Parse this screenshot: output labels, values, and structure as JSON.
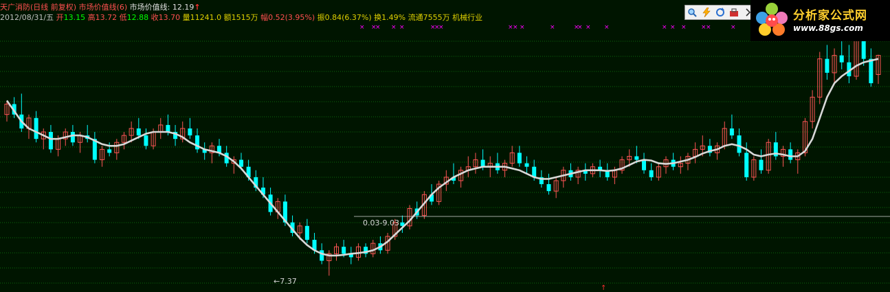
{
  "header": {
    "title": "天广消防(日线 前复权) 市场价值线(6)",
    "indicator_text": "市场价值线: 12.19",
    "up_arrow": "↑"
  },
  "quote": {
    "date": "2012/08/31/五",
    "open_label": "开",
    "open": "13.15",
    "high_label": "高",
    "high": "13.72",
    "low_label": "低",
    "low": "12.88",
    "close_label": "收",
    "close": "13.70",
    "volume_label": "量",
    "volume": "11241.0",
    "amount_label": "额",
    "amount": "1515万",
    "change_label": "幅",
    "change": "0.52(3.95%)",
    "amplitude_label": "振",
    "amplitude": "0.84(6.37%)",
    "turnover_label": "换",
    "turnover": "1.49%",
    "float_label": "流通",
    "float": "7555万",
    "industry": "机械行业"
  },
  "toolbar": {
    "icons": [
      "magnifier-icon",
      "lightning-icon",
      "refresh-icon",
      "toolbox-icon",
      "chevron-right-icon"
    ]
  },
  "logo": {
    "title": "分析家公式网",
    "url": "www.88gs.com"
  },
  "annotations": {
    "low_price": "←7.37",
    "range_label": "0.03-9.03"
  },
  "colors": {
    "background": "#001500",
    "grid": "#0b6a0b",
    "up": "#ff5555",
    "down": "#00ffff",
    "ma_line": "#d8d8d8",
    "date_text": "#c0c0c0",
    "label_red": "#ff5050",
    "value_green": "#00ff00",
    "title_text": "#e0d000",
    "cross_marks": "#ff00ff"
  },
  "chart_data": {
    "type": "candlestick",
    "ylim": [
      7.0,
      14.6
    ],
    "overlay_name": "市场价值线(6)",
    "candles": [
      [
        12.0,
        12.4,
        11.8,
        12.3
      ],
      [
        12.3,
        12.5,
        11.9,
        12.0
      ],
      [
        12.0,
        12.6,
        11.5,
        11.6
      ],
      [
        11.6,
        12.0,
        11.3,
        11.9
      ],
      [
        11.9,
        12.1,
        11.2,
        11.3
      ],
      [
        11.3,
        11.6,
        11.0,
        11.5
      ],
      [
        11.5,
        11.7,
        10.9,
        11.0
      ],
      [
        11.0,
        11.4,
        10.8,
        11.3
      ],
      [
        11.3,
        11.6,
        11.1,
        11.5
      ],
      [
        11.5,
        11.7,
        11.1,
        11.2
      ],
      [
        11.2,
        11.5,
        10.9,
        11.4
      ],
      [
        11.4,
        11.7,
        11.2,
        11.3
      ],
      [
        11.3,
        11.5,
        10.6,
        10.7
      ],
      [
        10.7,
        11.1,
        10.5,
        11.0
      ],
      [
        11.0,
        11.2,
        10.8,
        10.9
      ],
      [
        10.9,
        11.3,
        10.7,
        11.2
      ],
      [
        11.2,
        11.5,
        11.0,
        11.4
      ],
      [
        11.4,
        11.8,
        11.2,
        11.6
      ],
      [
        11.6,
        11.9,
        11.3,
        11.4
      ],
      [
        11.4,
        11.6,
        11.0,
        11.1
      ],
      [
        11.1,
        11.6,
        11.0,
        11.5
      ],
      [
        11.5,
        11.9,
        11.3,
        11.7
      ],
      [
        11.7,
        12.0,
        11.4,
        11.5
      ],
      [
        11.5,
        11.7,
        11.1,
        11.3
      ],
      [
        11.3,
        11.8,
        11.2,
        11.6
      ],
      [
        11.6,
        11.9,
        11.3,
        11.4
      ],
      [
        11.4,
        11.6,
        10.9,
        11.0
      ],
      [
        11.0,
        11.2,
        10.7,
        10.9
      ],
      [
        10.9,
        11.2,
        10.6,
        11.1
      ],
      [
        11.1,
        11.3,
        10.8,
        10.9
      ],
      [
        10.9,
        11.1,
        10.5,
        10.6
      ],
      [
        10.6,
        10.8,
        10.3,
        10.7
      ],
      [
        10.7,
        10.9,
        10.4,
        10.5
      ],
      [
        10.5,
        10.7,
        10.1,
        10.2
      ],
      [
        10.2,
        10.4,
        9.8,
        9.9
      ],
      [
        9.9,
        10.2,
        9.6,
        9.7
      ],
      [
        9.7,
        9.9,
        9.1,
        9.2
      ],
      [
        9.2,
        9.6,
        9.0,
        9.5
      ],
      [
        9.5,
        9.7,
        8.8,
        8.9
      ],
      [
        8.9,
        9.1,
        8.5,
        8.6
      ],
      [
        8.6,
        8.9,
        8.4,
        8.8
      ],
      [
        8.8,
        9.0,
        8.3,
        8.4
      ],
      [
        8.4,
        8.6,
        8.0,
        8.1
      ],
      [
        8.1,
        8.3,
        7.7,
        7.8
      ],
      [
        7.8,
        8.1,
        7.37,
        8.0
      ],
      [
        8.0,
        8.3,
        7.8,
        8.2
      ],
      [
        8.2,
        8.4,
        7.9,
        8.0
      ],
      [
        8.0,
        8.2,
        7.7,
        7.9
      ],
      [
        7.9,
        8.3,
        7.8,
        8.2
      ],
      [
        8.2,
        8.3,
        7.9,
        8.0
      ],
      [
        8.0,
        8.4,
        7.9,
        8.3
      ],
      [
        8.3,
        8.5,
        8.0,
        8.1
      ],
      [
        8.1,
        8.6,
        8.0,
        8.5
      ],
      [
        8.5,
        9.0,
        8.4,
        8.9
      ],
      [
        8.9,
        9.1,
        8.6,
        8.8
      ],
      [
        8.8,
        9.4,
        8.7,
        9.3
      ],
      [
        9.3,
        9.5,
        9.0,
        9.1
      ],
      [
        9.1,
        9.8,
        9.0,
        9.7
      ],
      [
        9.7,
        10.0,
        9.4,
        9.5
      ],
      [
        9.5,
        10.1,
        9.4,
        10.0
      ],
      [
        10.0,
        10.4,
        9.8,
        10.2
      ],
      [
        10.2,
        10.6,
        10.0,
        10.1
      ],
      [
        10.1,
        10.5,
        9.9,
        10.4
      ],
      [
        10.4,
        10.8,
        10.2,
        10.5
      ],
      [
        10.5,
        10.9,
        10.3,
        10.7
      ],
      [
        10.7,
        11.0,
        10.4,
        10.5
      ],
      [
        10.5,
        10.8,
        10.2,
        10.6
      ],
      [
        10.6,
        10.9,
        10.3,
        10.4
      ],
      [
        10.4,
        10.7,
        10.2,
        10.6
      ],
      [
        10.6,
        11.1,
        10.5,
        10.9
      ],
      [
        10.9,
        11.1,
        10.5,
        10.6
      ],
      [
        10.6,
        10.8,
        10.3,
        10.5
      ],
      [
        10.5,
        10.7,
        10.1,
        10.2
      ],
      [
        10.2,
        10.4,
        9.9,
        10.0
      ],
      [
        10.0,
        10.3,
        9.7,
        9.8
      ],
      [
        9.8,
        10.2,
        9.6,
        10.1
      ],
      [
        10.1,
        10.5,
        9.9,
        10.4
      ],
      [
        10.4,
        10.6,
        10.1,
        10.2
      ],
      [
        10.2,
        10.5,
        10.0,
        10.4
      ],
      [
        10.4,
        10.6,
        10.1,
        10.3
      ],
      [
        10.3,
        10.6,
        10.2,
        10.5
      ],
      [
        10.5,
        10.7,
        10.2,
        10.4
      ],
      [
        10.4,
        10.6,
        10.1,
        10.2
      ],
      [
        10.2,
        10.5,
        10.0,
        10.4
      ],
      [
        10.4,
        10.8,
        10.3,
        10.7
      ],
      [
        10.7,
        11.0,
        10.5,
        10.8
      ],
      [
        10.8,
        11.1,
        10.6,
        10.7
      ],
      [
        10.7,
        10.9,
        10.3,
        10.4
      ],
      [
        10.4,
        10.6,
        10.1,
        10.2
      ],
      [
        10.2,
        10.6,
        10.1,
        10.5
      ],
      [
        10.5,
        10.8,
        10.3,
        10.7
      ],
      [
        10.7,
        10.9,
        10.4,
        10.5
      ],
      [
        10.5,
        10.8,
        10.3,
        10.6
      ],
      [
        10.6,
        10.9,
        10.4,
        10.8
      ],
      [
        10.8,
        11.2,
        10.6,
        11.0
      ],
      [
        11.0,
        11.4,
        10.8,
        11.1
      ],
      [
        11.1,
        11.3,
        10.8,
        10.9
      ],
      [
        10.9,
        11.2,
        10.7,
        11.1
      ],
      [
        11.1,
        11.8,
        11.0,
        11.6
      ],
      [
        11.6,
        12.0,
        11.3,
        11.4
      ],
      [
        11.4,
        11.6,
        10.8,
        10.9
      ],
      [
        10.9,
        11.2,
        10.1,
        10.2
      ],
      [
        10.2,
        10.8,
        10.1,
        10.7
      ],
      [
        10.7,
        11.0,
        10.3,
        10.4
      ],
      [
        10.4,
        11.3,
        10.3,
        11.2
      ],
      [
        11.2,
        11.5,
        10.7,
        10.8
      ],
      [
        10.8,
        11.1,
        10.5,
        11.0
      ],
      [
        11.0,
        11.2,
        10.6,
        10.7
      ],
      [
        10.7,
        11.0,
        10.3,
        10.9
      ],
      [
        10.9,
        11.9,
        10.8,
        11.8
      ],
      [
        11.8,
        12.7,
        11.6,
        12.5
      ],
      [
        12.5,
        13.8,
        12.3,
        13.6
      ],
      [
        13.6,
        14.0,
        13.0,
        13.2
      ],
      [
        13.2,
        13.9,
        12.9,
        13.7
      ],
      [
        13.7,
        14.3,
        13.3,
        13.5
      ],
      [
        13.5,
        14.0,
        12.9,
        13.1
      ],
      [
        13.1,
        14.5,
        13.0,
        14.2
      ],
      [
        14.2,
        14.5,
        13.4,
        13.6
      ],
      [
        13.6,
        13.9,
        12.8,
        12.9
      ],
      [
        13.15,
        13.72,
        12.88,
        13.7
      ]
    ],
    "overlay_values": [
      12.4,
      12.1,
      11.8,
      11.6,
      11.5,
      11.4,
      11.3,
      11.3,
      11.35,
      11.4,
      11.4,
      11.35,
      11.25,
      11.15,
      11.1,
      11.1,
      11.15,
      11.25,
      11.35,
      11.45,
      11.5,
      11.5,
      11.5,
      11.45,
      11.35,
      11.2,
      11.1,
      11.0,
      10.95,
      10.9,
      10.8,
      10.65,
      10.45,
      10.2,
      9.95,
      9.7,
      9.45,
      9.2,
      8.95,
      8.7,
      8.45,
      8.25,
      8.1,
      8.0,
      7.95,
      7.95,
      7.97,
      8.0,
      8.02,
      8.05,
      8.1,
      8.2,
      8.35,
      8.55,
      8.75,
      8.95,
      9.2,
      9.45,
      9.7,
      9.9,
      10.05,
      10.2,
      10.3,
      10.4,
      10.45,
      10.5,
      10.5,
      10.5,
      10.5,
      10.45,
      10.4,
      10.3,
      10.2,
      10.15,
      10.15,
      10.2,
      10.25,
      10.3,
      10.35,
      10.4,
      10.4,
      10.4,
      10.38,
      10.4,
      10.45,
      10.55,
      10.65,
      10.7,
      10.68,
      10.6,
      10.58,
      10.6,
      10.65,
      10.7,
      10.78,
      10.88,
      10.95,
      11.0,
      11.1,
      11.15,
      11.1,
      11.0,
      10.85,
      10.8,
      10.85,
      10.88,
      10.85,
      10.8,
      10.8,
      10.95,
      11.3,
      11.9,
      12.5,
      12.9,
      13.1,
      13.25,
      13.4,
      13.5,
      13.55,
      13.6
    ]
  }
}
